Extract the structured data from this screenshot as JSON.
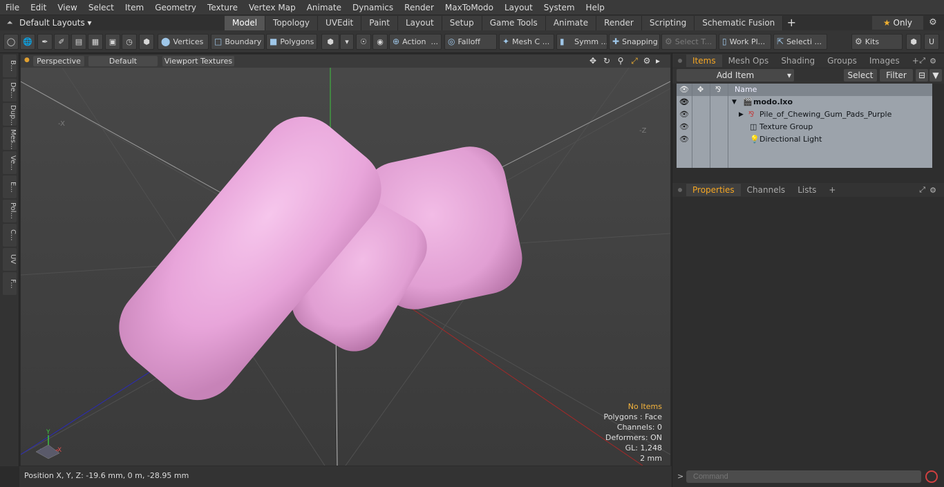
{
  "menu": [
    "File",
    "Edit",
    "View",
    "Select",
    "Item",
    "Geometry",
    "Texture",
    "Vertex Map",
    "Animate",
    "Dynamics",
    "Render",
    "MaxToModo",
    "Layout",
    "System",
    "Help"
  ],
  "layout": {
    "layouts_label": "Default Layouts ▾",
    "tabs": [
      "Model",
      "Topology",
      "UVEdit",
      "Paint",
      "Layout",
      "Setup",
      "Game Tools",
      "Animate",
      "Render",
      "Scripting",
      "Schematic Fusion"
    ],
    "active_tab": "Model",
    "only_label": "Only",
    "only_star": "★"
  },
  "toolbar": {
    "vertices": "Vertices",
    "boundary": "Boundary",
    "polygons": "Polygons",
    "action": "Action",
    "action_more": "...",
    "falloff": "Falloff",
    "mesh": "Mesh C ...",
    "symmetry": "Symm ...",
    "snapping": "Snapping",
    "select_t": "Select T...",
    "work_plane": "Work Pl...",
    "selection": "Selecti ...",
    "kits": "Kits"
  },
  "left_tabs": [
    "B...",
    "De...",
    "Dup...",
    "Mes...",
    "Ve...",
    "E...",
    "Pol...",
    "C...",
    "UV",
    "F..."
  ],
  "viewport": {
    "view_mode": "Perspective",
    "shading": "Default",
    "textures": "Viewport Textures",
    "axis_neg_x": "-X",
    "axis_neg_z": "-Z",
    "gizmo_y": "Y",
    "gizmo_x": "X",
    "stats": {
      "no_items": "No Items",
      "polygons": "Polygons : Face",
      "channels": "Channels: 0",
      "deformers": "Deformers: ON",
      "gl": "GL: 1,248",
      "scale": "2 mm"
    },
    "gum_color": "#e9a7dc"
  },
  "status": {
    "position": "Position X, Y, Z:   -19.6 mm, 0 m, -28.95 mm"
  },
  "items_panel": {
    "tabs": [
      "Items",
      "Mesh Ops",
      "Shading",
      "Groups",
      "Images"
    ],
    "add_item": "Add Item",
    "select": "Select",
    "filter": "Filter",
    "name_header": "Name",
    "rows": [
      {
        "label": "modo.lxo",
        "icon": "scene-icon"
      },
      {
        "label": "Pile_of_Chewing_Gum_Pads_Purple",
        "icon": "mesh-icon"
      },
      {
        "label": "Texture Group",
        "icon": "texture-group-icon"
      },
      {
        "label": "Directional Light",
        "icon": "light-icon"
      }
    ]
  },
  "properties_panel": {
    "tabs": [
      "Properties",
      "Channels",
      "Lists"
    ]
  },
  "command": {
    "placeholder": "Command"
  }
}
